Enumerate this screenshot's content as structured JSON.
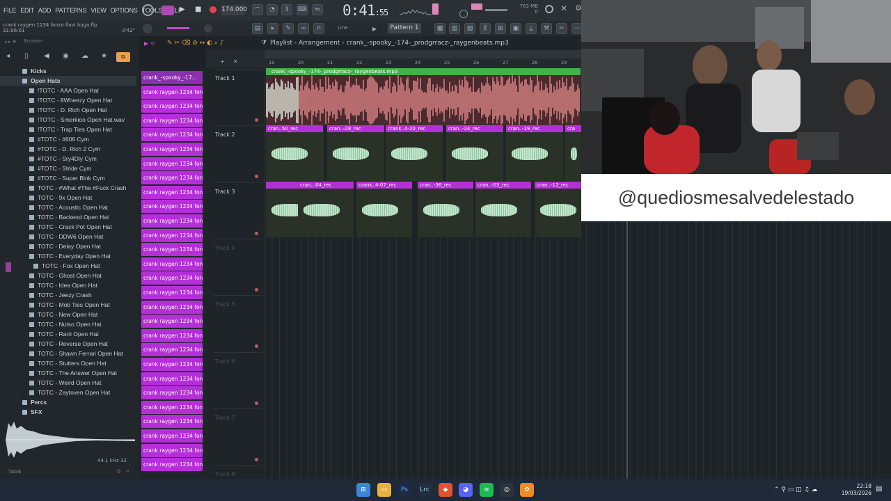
{
  "menubar": {
    "items": [
      "FILE",
      "EDIT",
      "ADD",
      "PATTERNS",
      "VIEW",
      "OPTIONS",
      "TOOLS",
      "HELP"
    ]
  },
  "transport": {
    "tempo": "174.000",
    "time_main": "0:41",
    "time_sub": ":55",
    "memory_top": "763 MB",
    "memory_bottom": "0"
  },
  "song": {
    "name": "crank raygen 1234 fonzo flavi hugo.flp",
    "position": "31:06:01",
    "time_hint": "0'42\""
  },
  "toolbar2": {
    "snap_label": "Line",
    "pattern": "Pattern 1"
  },
  "browser": {
    "title": "Browser",
    "items": [
      {
        "label": "Kicks",
        "type": "folder",
        "level": 1
      },
      {
        "label": "Open Hats",
        "type": "folder",
        "level": 1
      },
      {
        "label": "!TOTC - AAA Open Hat",
        "type": "file",
        "level": 2
      },
      {
        "label": "!TOTC - 8Wheezy Open Hat",
        "type": "file",
        "level": 2
      },
      {
        "label": "!TOTC - D. Rich Open Hat",
        "type": "file",
        "level": 2
      },
      {
        "label": "!TOTC - Smerkioo Open Hat.wav",
        "type": "file",
        "level": 2
      },
      {
        "label": "!TOTC - Trap Ties Open Hat",
        "type": "file",
        "level": 2
      },
      {
        "label": "#TOTC - #606 Cym",
        "type": "file",
        "level": 2
      },
      {
        "label": "#TOTC - D. Rich 2 Cym",
        "type": "file",
        "level": 2
      },
      {
        "label": "#TOTC - Sry4Dly Cym",
        "type": "file",
        "level": 2
      },
      {
        "label": "#TOTC - Stride Cym",
        "type": "file",
        "level": 2
      },
      {
        "label": "#TOTC - Super Bink Cym",
        "type": "file",
        "level": 2
      },
      {
        "label": "TOTC - #What #The #Fuck Crash",
        "type": "file",
        "level": 2
      },
      {
        "label": "TOTC - 9x Open Hat",
        "type": "file",
        "level": 2
      },
      {
        "label": "TOTC - Acoustic Open Hat",
        "type": "file",
        "level": 2
      },
      {
        "label": "TOTC - Backend Open Hat",
        "type": "file",
        "level": 2
      },
      {
        "label": "TOTC - Crack Pot Open Hat",
        "type": "file",
        "level": 2
      },
      {
        "label": "TOTC - DDW6 Open Hat",
        "type": "file",
        "level": 2
      },
      {
        "label": "TOTC - Delay Open Hat",
        "type": "file",
        "level": 2
      },
      {
        "label": "TOTC - Everyday Open Hat",
        "type": "file",
        "level": 2
      },
      {
        "label": "TOTC - Fox Open Hat",
        "type": "file",
        "level": 3
      },
      {
        "label": "TOTC - Ghost Open Hat",
        "type": "file",
        "level": 2
      },
      {
        "label": "TOTC - Idea Open Hat",
        "type": "file",
        "level": 2
      },
      {
        "label": "TOTC - Jeezy Crash",
        "type": "file",
        "level": 2
      },
      {
        "label": "TOTC - Mob Ties Open Hat",
        "type": "file",
        "level": 2
      },
      {
        "label": "TOTC - New Open Hat",
        "type": "file",
        "level": 2
      },
      {
        "label": "TOTC - Nutso Open Hat",
        "type": "file",
        "level": 2
      },
      {
        "label": "TOTC - Rarri Open Hat",
        "type": "file",
        "level": 2
      },
      {
        "label": "TOTC - Reverse Open Hat",
        "type": "file",
        "level": 2
      },
      {
        "label": "TOTC - Shawn Ferrari Open Hat",
        "type": "file",
        "level": 2
      },
      {
        "label": "TOTC - Stutters Open Hat",
        "type": "file",
        "level": 2
      },
      {
        "label": "TOTC - The Answer Open Hat",
        "type": "file",
        "level": 2
      },
      {
        "label": "TOTC - Weird Open Hat",
        "type": "file",
        "level": 2
      },
      {
        "label": "TOTC - Zaytoven Open Hat",
        "type": "file",
        "level": 2
      },
      {
        "label": "Percs",
        "type": "folder",
        "level": 1
      },
      {
        "label": "SFX",
        "type": "folder",
        "level": 1
      }
    ],
    "sample_info": "44.1 kHz 32",
    "tags_label": "TAGS"
  },
  "channels": {
    "first": "crank_-spooky_-17...",
    "rest": "crank raygen 1234 fonzo...",
    "count": 28
  },
  "playlist": {
    "title": "Playlist - Arrangement",
    "breadcrumb": "crank_-spooky_-174-_prodgrracz-_raygenbeats.mp3",
    "ruler": [
      "19",
      "20",
      "21",
      "22",
      "23",
      "24",
      "25",
      "26",
      "27",
      "28",
      "29"
    ],
    "tracks": [
      "Track 1",
      "Track 2",
      "Track 3",
      "Track 4",
      "Track 5",
      "Track 6",
      "Track 7",
      "Track 8"
    ],
    "track1_clip": "crank_-spooky_-174-_prodgrracz-_raygenbeats.mp3",
    "track2_clips": [
      "cran..50_rec",
      "cran..-28_rec",
      "crank..4-20_rec",
      "cran..-24_rec",
      "cran..-19_rec",
      "cra"
    ],
    "track3_clips": [
      "",
      "cran...04_rec",
      "crank..4-07_rec",
      "cran..-36_rec",
      "cran..-03_rec",
      "cran..-12_rec"
    ]
  },
  "overlay": {
    "handle": "@quediosmesalvedelestado"
  },
  "taskbar": {
    "time": "22:18",
    "date": "19/03/2026"
  },
  "colors": {
    "clip": "#b52fd8",
    "audio_clip": "#3fb24a",
    "accent": "#e8a14b"
  }
}
